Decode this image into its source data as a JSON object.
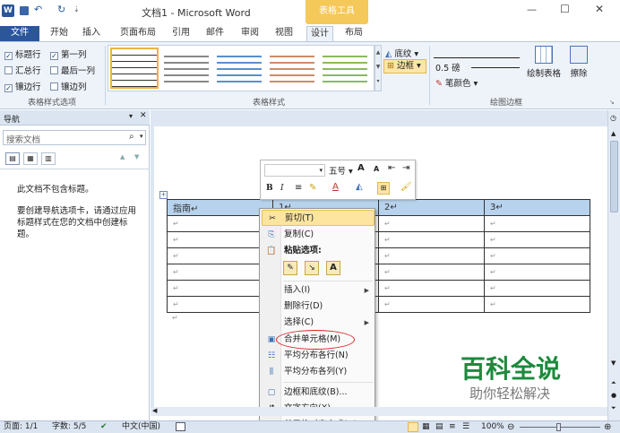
{
  "window": {
    "title": "文档1 - Microsoft Word",
    "context_tab": "表格工具",
    "controls": [
      "—",
      "☐",
      "✕"
    ]
  },
  "quick_access": {
    "app_icon": "W",
    "undo": "↶",
    "redo": "↻"
  },
  "ribbon_tabs": [
    "文件",
    "开始",
    "插入",
    "页面布局",
    "引用",
    "邮件",
    "审阅",
    "视图",
    "设计",
    "布局"
  ],
  "style_options": {
    "items": [
      {
        "label": "标题行",
        "checked": true
      },
      {
        "label": "第一列",
        "checked": true
      },
      {
        "label": "汇总行",
        "checked": false
      },
      {
        "label": "最后一列",
        "checked": false
      },
      {
        "label": "镶边行",
        "checked": true
      },
      {
        "label": "镶边列",
        "checked": false
      }
    ],
    "group_label": "表格样式选项"
  },
  "table_styles": {
    "group_label": "表格样式",
    "shading_label": "底纹",
    "borders_label": "边框"
  },
  "draw_borders": {
    "line_weight": "0.5 磅",
    "pen_color": "笔颜色",
    "draw_table": "绘制表格",
    "eraser": "擦除",
    "group_label": "绘图边框"
  },
  "nav": {
    "title": "导航",
    "search_placeholder": "搜索文档",
    "empty_title": "此文档不包含标题。",
    "hint": "要创建导航选项卡，请通过应用标题样式在您的文档中创建标题。"
  },
  "mini_toolbar": {
    "font_size": "五号",
    "grow": "A",
    "shrink": "A",
    "bold": "B",
    "italic": "I"
  },
  "doc_table": {
    "headers": [
      "指南↵",
      "1↵",
      "2↵",
      "3↵"
    ],
    "rows": [
      [
        "↵",
        "↵",
        "↵",
        "↵"
      ],
      [
        "↵",
        "↵",
        "↵",
        "↵"
      ],
      [
        "↵",
        "↵",
        "↵",
        "↵"
      ],
      [
        "↵",
        "↵",
        "↵",
        "↵"
      ],
      [
        "↵",
        "↵",
        "↵",
        "↵"
      ],
      [
        "↵",
        "↵",
        "↵",
        "↵"
      ]
    ]
  },
  "context_menu": {
    "items": [
      {
        "label": "剪切(T)",
        "icon": "scissors-icon",
        "highlight": true
      },
      {
        "label": "复制(C)",
        "icon": "copy-icon"
      },
      {
        "label": "粘贴选项:",
        "icon": "paste-icon",
        "bold": true
      },
      {
        "label": "插入(I)",
        "submenu": true
      },
      {
        "label": "删除行(D)"
      },
      {
        "label": "选择(C)",
        "submenu": true
      },
      {
        "label": "合并单元格(M)",
        "icon": "merge-cells-icon",
        "circled": true
      },
      {
        "label": "平均分布各行(N)",
        "icon": "distribute-rows-icon"
      },
      {
        "label": "平均分布各列(Y)",
        "icon": "distribute-columns-icon"
      },
      {
        "label": "边框和底纹(B)...",
        "icon": "borders-icon"
      },
      {
        "label": "文字方向(X)...",
        "icon": "text-direction-icon"
      },
      {
        "label": "单元格对齐方式(G)",
        "submenu": true
      }
    ],
    "paste_option_A": "A"
  },
  "status": {
    "page": "页面: 1/1",
    "words": "字数: 5/5",
    "lang": "中文(中国)",
    "zoom": "100%"
  },
  "watermark": {
    "title": "百科全说",
    "subtitle": "助你轻松解决",
    "color": "#1d8a3c"
  }
}
